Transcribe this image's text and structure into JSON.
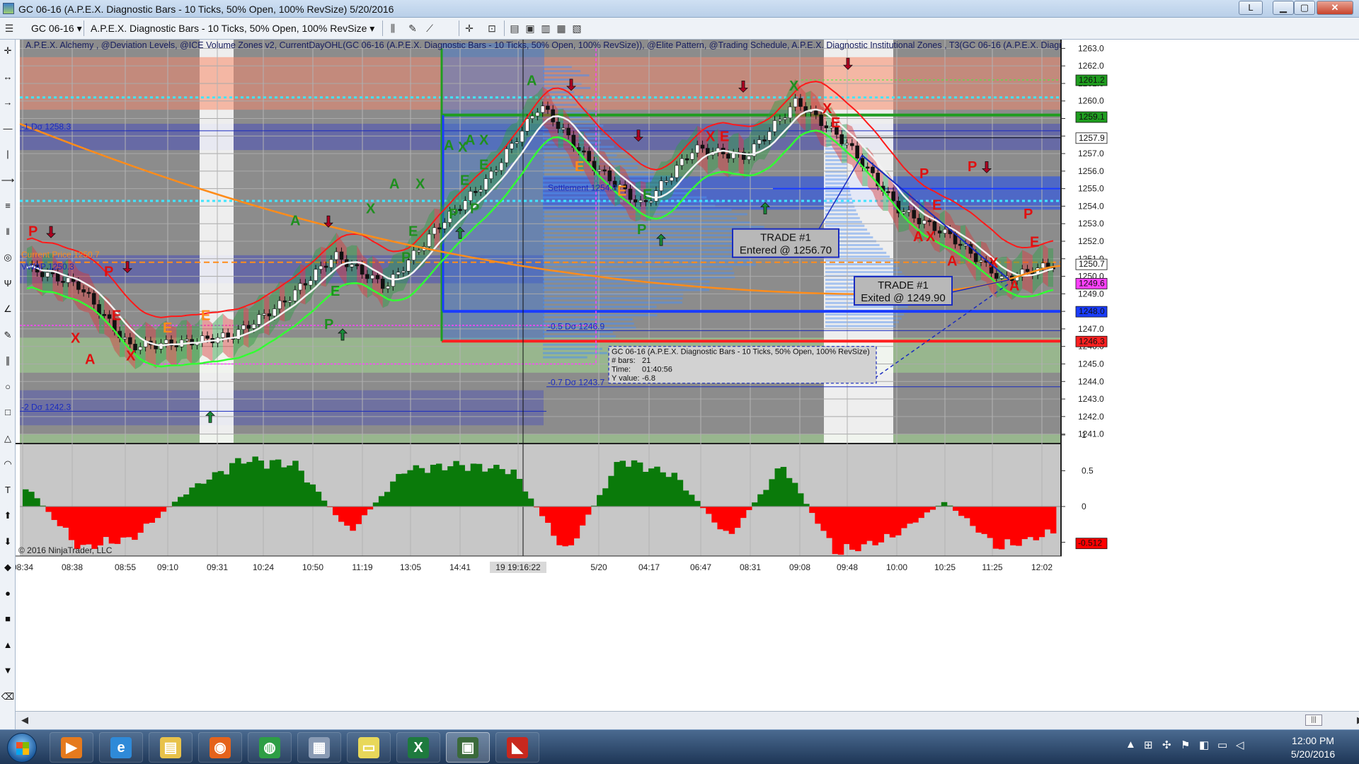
{
  "window": {
    "title": "GC 06-16 (A.P.E.X. Diagnostic Bars - 10 Ticks, 50% Open, 100% RevSize)  5/20/2016",
    "buttons": {
      "layout": "L",
      "minimize": "▁",
      "maximize": "▢",
      "close": "✕"
    }
  },
  "toolbar": {
    "instrument": "GC 06-16",
    "bar_type": "A.P.E.X. Diagnostic Bars - 10 Ticks, 50% Open, 100% RevSize",
    "caret": "▾"
  },
  "drawing_tools": [
    {
      "icon": "crosshair-icon",
      "glyph": "✛"
    },
    {
      "icon": "horizontal-arrow-icon",
      "glyph": "↔"
    },
    {
      "icon": "arrow-right-icon",
      "glyph": "→"
    },
    {
      "icon": "horizontal-line-icon",
      "glyph": "—"
    },
    {
      "icon": "vertical-line-icon",
      "glyph": "|"
    },
    {
      "icon": "ray-icon",
      "glyph": "⟶"
    },
    {
      "icon": "fib-icon",
      "glyph": "≡"
    },
    {
      "icon": "bars-icon",
      "glyph": "‖"
    },
    {
      "icon": "target-icon",
      "glyph": "◎"
    },
    {
      "icon": "pitchfork-icon",
      "glyph": "Ψ"
    },
    {
      "icon": "angle-icon",
      "glyph": "∠"
    },
    {
      "icon": "pencil-icon",
      "glyph": "✎"
    },
    {
      "icon": "channel-icon",
      "glyph": "∥"
    },
    {
      "icon": "ellipse-icon",
      "glyph": "○"
    },
    {
      "icon": "rectangle-icon",
      "glyph": "□"
    },
    {
      "icon": "triangle-icon",
      "glyph": "△"
    },
    {
      "icon": "arc-icon",
      "glyph": "◠"
    },
    {
      "icon": "text-icon",
      "glyph": "T"
    },
    {
      "icon": "arrow-up-green-icon",
      "glyph": "⬆"
    },
    {
      "icon": "arrow-down-red-icon",
      "glyph": "⬇"
    },
    {
      "icon": "diamond-icon",
      "glyph": "◆"
    },
    {
      "icon": "dot-icon",
      "glyph": "●"
    },
    {
      "icon": "square-icon",
      "glyph": "■"
    },
    {
      "icon": "triangle-up-icon",
      "glyph": "▲"
    },
    {
      "icon": "triangle-down-icon",
      "glyph": "▼"
    },
    {
      "icon": "eraser-icon",
      "glyph": "⌫"
    }
  ],
  "chart": {
    "indicator_list": "A.P.E.X. Alchemy , @Deviation Levels, @ICE Volume Zones v2, CurrentDayOHL(GC 06-16 (A.P.E.X. Diagnostic Bars - 10 Ticks, 50% Open, 100% RevSize)), @Elite Pattern, @Trading Schedule, A.P.E.X. Diagnostic Institutional Zones , T3(GC 06-16 (A.P.E.X. Diagnostic Bars - 10 Ticks, 50% Ope",
    "copyright": "© 2016 NinjaTrader, LLC",
    "price_labels": [
      "1263.0",
      "1262.0",
      "1261.0",
      "1260.0",
      "1259.0",
      "1258.0",
      "1257.0",
      "1256.0",
      "1255.0",
      "1254.0",
      "1253.0",
      "1252.0",
      "1251.0",
      "1250.0",
      "1249.0",
      "1248.0",
      "1247.0",
      "1246.0",
      "1245.0",
      "1244.0",
      "1243.0",
      "1242.0",
      "1241.0"
    ],
    "price_tags": [
      {
        "value": 1261.2,
        "label": "1261.2",
        "color": "#1f9d1f"
      },
      {
        "value": 1259.1,
        "label": "1259.1",
        "color": "#1f9d1f"
      },
      {
        "value": 1257.9,
        "label": "1257.9",
        "color": "#ffffff"
      },
      {
        "value": 1250.7,
        "label": "1250.7",
        "color": "#ffffff"
      },
      {
        "value": 1249.6,
        "label": "1249.6",
        "color": "#ff40ff"
      },
      {
        "value": 1248.0,
        "label": "1248.0",
        "color": "#1a3cff"
      },
      {
        "value": 1246.3,
        "label": "1246.3",
        "color": "#ff2020"
      }
    ],
    "level_labels": [
      {
        "text": "-1 Dσ 1258.3",
        "value": 1258.3
      },
      {
        "text": "-2 Dσ 1242.3",
        "value": 1242.3
      },
      {
        "text": "Current Price  1250.7",
        "value": 1251.0
      },
      {
        "text": "VWAP 1250.3",
        "value": 1250.3
      },
      {
        "text": "Settlement  1254.8",
        "value": 1254.8
      },
      {
        "text": "-0.5 Dσ 1246.9",
        "value": 1246.9
      },
      {
        "text": "-0.7 Dσ 1243.7",
        "value": 1243.7
      }
    ],
    "time_labels": [
      "08:34",
      "08:38",
      "08:55",
      "09:10",
      "09:31",
      "10:24",
      "10:50",
      "11:19",
      "13:05",
      "14:41",
      "19 19:16:22",
      "5/20",
      "04:17",
      "06:47",
      "08:31",
      "09:08",
      "09:48",
      "10:00",
      "10:25",
      "11:25",
      "12:02"
    ],
    "trade_entry": {
      "line1": "TRADE #1",
      "line2": "Entered @ 1256.70"
    },
    "trade_exit": {
      "line1": "TRADE #1",
      "line2": "Exited @ 1249.90"
    },
    "info_box": {
      "title": "GC 06-16 (A.P.E.X. Diagnostic Bars - 10 Ticks, 50% Open, 100% RevSize)",
      "bars_label": "# bars:",
      "bars_value": "21",
      "time_label": "Time:",
      "time_value": "01:40:56",
      "y_label": "Y value:",
      "y_value": "-6.8"
    },
    "signal_labels": {
      "A": "A",
      "X": "X",
      "E": "E",
      "P": "P"
    },
    "indicator_panel": {
      "ticks": [
        "1",
        "0.5",
        "0",
        "-0.5"
      ],
      "last_value": "-0.512",
      "up_color": "#0a7a0a",
      "down_color": "#ff0000"
    }
  },
  "chart_data": {
    "type": "candlestick",
    "title": "GC 06-16 (A.P.E.X. Diagnostic Bars - 10 Ticks, 50% Open, 100% RevSize)  5/20/2016",
    "xlabel": "",
    "ylabel": "",
    "ylim": [
      1240.5,
      1263.5
    ],
    "x": [
      "08:34",
      "08:38",
      "08:55",
      "09:10",
      "09:31",
      "10:24",
      "10:50",
      "11:19",
      "13:05",
      "14:41",
      "5/20",
      "04:17",
      "06:47",
      "08:31",
      "09:08",
      "09:48",
      "10:00",
      "10:25",
      "11:25",
      "12:02"
    ],
    "price_close": [
      1250.5,
      1249.5,
      1246.0,
      1246.2,
      1246.6,
      1248.5,
      1251.2,
      1249.4,
      1252.8,
      1255.6,
      1259.8,
      1256.4,
      1254.0,
      1257.3,
      1256.8,
      1260.0,
      1257.5,
      1253.8,
      1252.3,
      1249.8,
      1250.7
    ],
    "oscillator": [
      0.4,
      -0.8,
      -0.6,
      0.3,
      0.9,
      0.8,
      -0.5,
      0.7,
      0.8,
      0.7,
      -0.9,
      0.9,
      0.6,
      -0.6,
      0.8,
      -0.9,
      -0.6,
      0.1,
      -0.8,
      -0.5
    ],
    "legend": "none",
    "grid": true
  },
  "taskbar": {
    "apps": [
      {
        "name": "media-player",
        "glyph": "▶",
        "color": "#e57a1e"
      },
      {
        "name": "internet-explorer",
        "glyph": "e",
        "color": "#2f8ad8"
      },
      {
        "name": "file-explorer",
        "glyph": "▤",
        "color": "#e8c24a"
      },
      {
        "name": "firefox",
        "glyph": "◉",
        "color": "#e5631c"
      },
      {
        "name": "chrome",
        "glyph": "◍",
        "color": "#2e9e45"
      },
      {
        "name": "calculator",
        "glyph": "▦",
        "color": "#8a9bb4"
      },
      {
        "name": "sticky-notes",
        "glyph": "▭",
        "color": "#e8d85a"
      },
      {
        "name": "excel",
        "glyph": "X",
        "color": "#1e7a3e"
      },
      {
        "name": "ninjatrader",
        "glyph": "▣",
        "color": "#3b6a3b"
      },
      {
        "name": "apex-app",
        "glyph": "◣",
        "color": "#c8281e"
      }
    ],
    "tray_icons": [
      "▲",
      "⊞",
      "✣",
      "⚑",
      "◧",
      "▭",
      "◁"
    ],
    "time": "12:00 PM",
    "date": "5/20/2016"
  }
}
